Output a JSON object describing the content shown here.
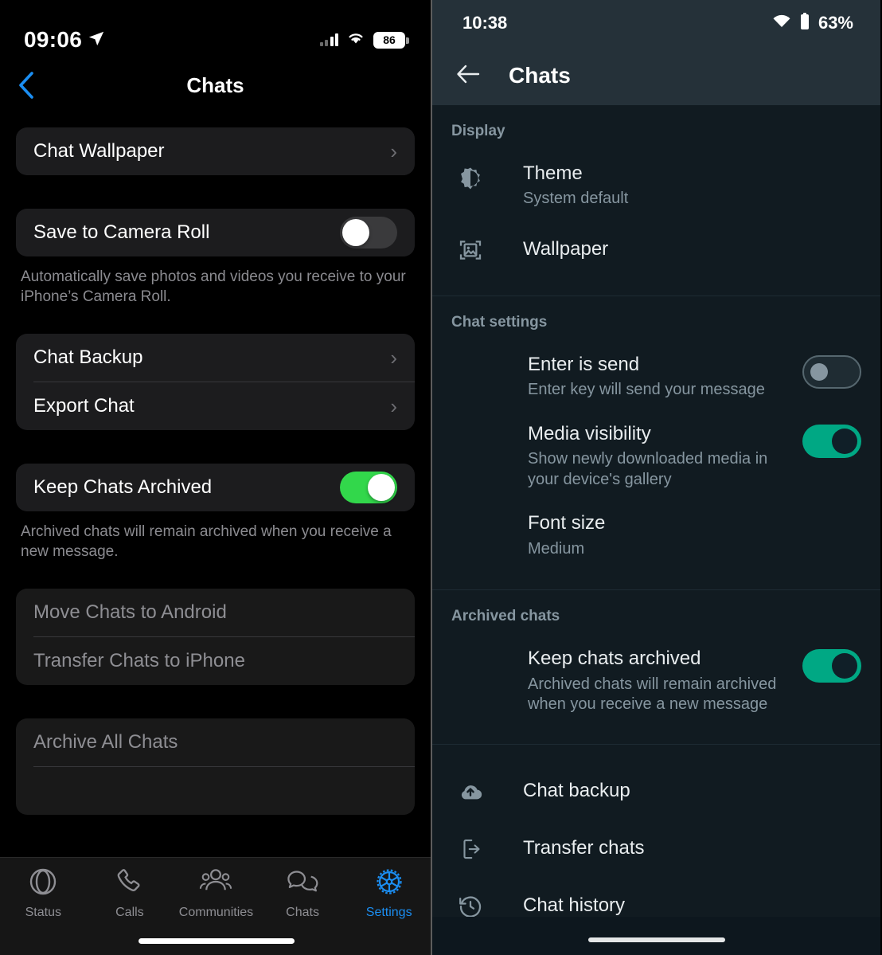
{
  "ios": {
    "status": {
      "time": "09:06",
      "battery": "86",
      "location_icon": "location-arrow-icon",
      "wifi_icon": "wifi-icon",
      "signal_icon": "cellular-signal-icon"
    },
    "nav": {
      "back_icon": "back-chevron-icon",
      "title": "Chats"
    },
    "groups": [
      {
        "rows": [
          {
            "label": "Chat Wallpaper",
            "type": "link"
          }
        ]
      },
      {
        "rows": [
          {
            "label": "Save to Camera Roll",
            "type": "switch",
            "value": "off"
          }
        ],
        "footnote": "Automatically save photos and videos you receive to your iPhone’s Camera Roll."
      },
      {
        "rows": [
          {
            "label": "Chat Backup",
            "type": "link"
          },
          {
            "label": "Export Chat",
            "type": "link"
          }
        ]
      },
      {
        "rows": [
          {
            "label": "Keep Chats Archived",
            "type": "switch",
            "value": "on"
          }
        ],
        "footnote": "Archived chats will remain archived when you receive a new message."
      },
      {
        "rows": [
          {
            "label": "Move Chats to Android",
            "type": "disabled"
          },
          {
            "label": "Transfer Chats to iPhone",
            "type": "disabled"
          }
        ]
      },
      {
        "rows": [
          {
            "label": "Archive All Chats",
            "type": "disabled"
          }
        ]
      }
    ],
    "tabs": [
      {
        "label": "Status",
        "icon": "status-ring-icon",
        "active": false
      },
      {
        "label": "Calls",
        "icon": "phone-icon",
        "active": false
      },
      {
        "label": "Communities",
        "icon": "communities-icon",
        "active": false
      },
      {
        "label": "Chats",
        "icon": "chat-bubbles-icon",
        "active": false
      },
      {
        "label": "Settings",
        "icon": "gear-icon",
        "active": true
      }
    ],
    "accent": "#1b8ef2",
    "switch_on_color": "#32d74b"
  },
  "android": {
    "status": {
      "time": "10:38",
      "battery": "63%",
      "wifi_icon": "wifi-icon",
      "battery_icon": "battery-icon"
    },
    "nav": {
      "back_icon": "back-arrow-icon",
      "title": "Chats"
    },
    "sections": [
      {
        "title": "Display",
        "rows": [
          {
            "icon": "theme-brightness-icon",
            "title": "Theme",
            "subtitle": "System default"
          },
          {
            "icon": "wallpaper-image-icon",
            "title": "Wallpaper",
            "subtitle": ""
          }
        ]
      },
      {
        "title": "Chat settings",
        "rows": [
          {
            "icon": "",
            "title": "Enter is send",
            "subtitle": "Enter key will send your message",
            "control": "switch",
            "value": "off"
          },
          {
            "icon": "",
            "title": "Media visibility",
            "subtitle": "Show newly downloaded media in your device's gallery",
            "control": "switch",
            "value": "on"
          },
          {
            "icon": "",
            "title": "Font size",
            "subtitle": "Medium"
          }
        ]
      },
      {
        "title": "Archived chats",
        "rows": [
          {
            "icon": "",
            "title": "Keep chats archived",
            "subtitle": "Archived chats will remain archived when you receive a new message",
            "control": "switch",
            "value": "on"
          }
        ]
      },
      {
        "title": "",
        "rows": [
          {
            "icon": "cloud-upload-icon",
            "title": "Chat backup",
            "subtitle": ""
          },
          {
            "icon": "transfer-chats-icon",
            "title": "Transfer chats",
            "subtitle": ""
          },
          {
            "icon": "history-clock-icon",
            "title": "Chat history",
            "subtitle": ""
          }
        ]
      }
    ],
    "accent": "#00a884",
    "header_color": "#253139",
    "background": "#111b21"
  }
}
